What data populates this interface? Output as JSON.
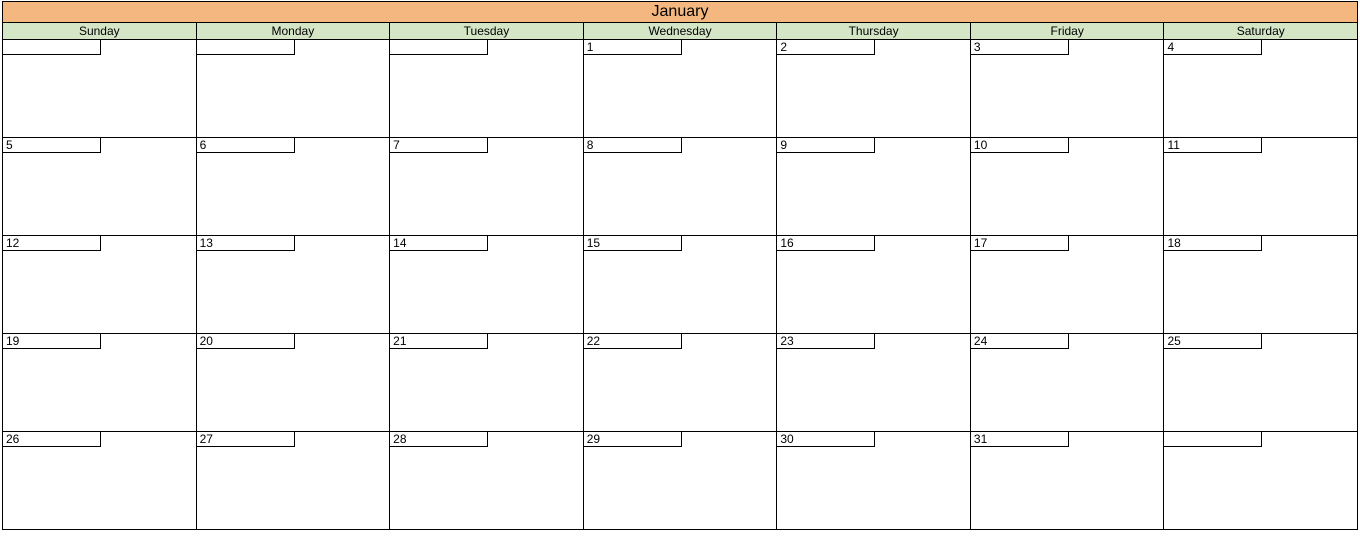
{
  "month_title": "January",
  "weekdays": [
    "Sunday",
    "Monday",
    "Tuesday",
    "Wednesday",
    "Thursday",
    "Friday",
    "Saturday"
  ],
  "weeks": [
    [
      "",
      "",
      "",
      "1",
      "2",
      "3",
      "4"
    ],
    [
      "5",
      "6",
      "7",
      "8",
      "9",
      "10",
      "11"
    ],
    [
      "12",
      "13",
      "14",
      "15",
      "16",
      "17",
      "18"
    ],
    [
      "19",
      "20",
      "21",
      "22",
      "23",
      "24",
      "25"
    ],
    [
      "26",
      "27",
      "28",
      "29",
      "30",
      "31",
      ""
    ]
  ],
  "colors": {
    "month_header_bg": "#f4b77f",
    "weekday_header_bg": "#d4e6c6",
    "border": "#000000"
  }
}
